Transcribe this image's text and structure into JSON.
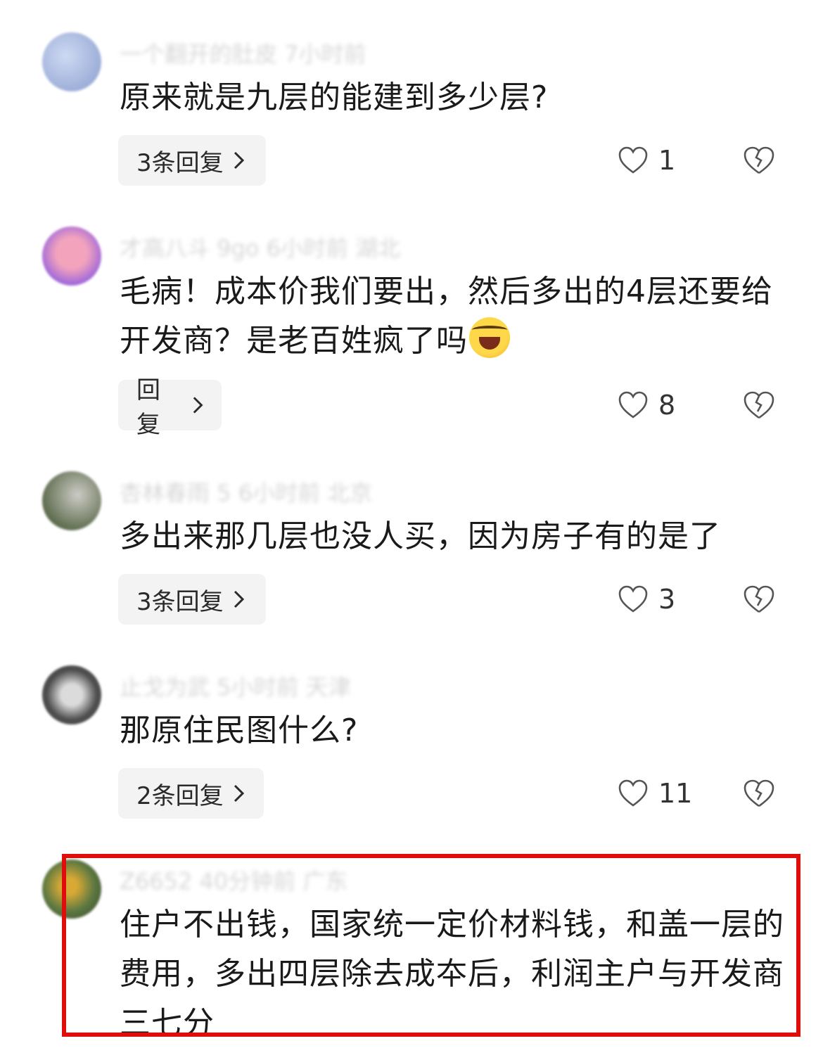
{
  "comments": [
    {
      "meta": "一个翻开的肚皮 7小时前",
      "text": "原来就是九层的能建到多少层?",
      "reply_label": "3条回复",
      "likes": "1",
      "avatar_color": "#8ea4d6"
    },
    {
      "meta": "才高八斗 9go 6小时前 湖北",
      "text": "毛病！成本价我们要出，然后多出的4层还要给开发商？是老百姓疯了吗",
      "emoji": "laughing-crying-emoji",
      "reply_label": "回复",
      "likes": "8",
      "avatar_color": "#9a5bd6"
    },
    {
      "meta": "杏林春雨 5 6小时前 北京",
      "text": "多出来那几层也没人买，因为房子有的是了",
      "reply_label": "3条回复",
      "likes": "3",
      "avatar_color": "#6c7a5a"
    },
    {
      "meta": "止戈为武 5小时前 天津",
      "text": "那原住民图什么?",
      "reply_label": "2条回复",
      "likes": "11",
      "avatar_color": "#444444"
    },
    {
      "meta": "Z6652 40分钟前 广东",
      "text": "住户不出钱，国家统一定价材料钱，和盖一层的费用，多出四层除去成夲后，利润主户与开发商三七分",
      "avatar_color": "#4d6b2e"
    }
  ],
  "colors": {
    "highlight_border": "#e00d0d",
    "reply_bg": "#f3f3f4"
  }
}
